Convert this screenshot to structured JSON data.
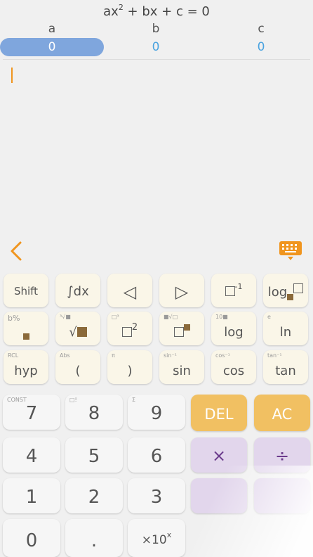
{
  "equation": {
    "lhs": "ax",
    "exponent": "2",
    "rest": " + bx + c = 0"
  },
  "coefficients": [
    {
      "label": "a",
      "value": "0"
    },
    {
      "label": "b",
      "value": "0"
    },
    {
      "label": "c",
      "value": "0"
    }
  ],
  "colors": {
    "accent": "#f0951e",
    "active_field": "#7fa6dd",
    "value_text": "#4aa3e0",
    "del_ac": "#f1c062",
    "operator": "#e2d6ec"
  },
  "keys": {
    "shift": "Shift",
    "integral": "∫dx",
    "left": "◁",
    "right": "▷",
    "inverse_sup": "-1",
    "log_base": "log",
    "percent_sub": "b%",
    "sqrt_sub": "³√■",
    "sqrt": "√",
    "square_sub": "□³",
    "square_sup": "2",
    "pow_sub": "■√□",
    "log_sub": "10■",
    "log": "log",
    "ln_sub": "e",
    "ln": "ln",
    "hyp_sub": "RCL",
    "hyp": "hyp",
    "lparen_sub": "Abs",
    "lparen": "(",
    "rparen_sub": "π",
    "rparen": ")",
    "sin_sub": "sin⁻¹",
    "sin": "sin",
    "cos_sub": "cos⁻¹",
    "cos": "cos",
    "tan_sub": "tan⁻¹",
    "tan": "tan",
    "seven_sub": "CONST",
    "seven": "7",
    "eight_sub": "□!",
    "eight": "8",
    "nine_sub": "Σ",
    "nine": "9",
    "del": "DEL",
    "ac": "AC",
    "four": "4",
    "five": "5",
    "six": "6",
    "multiply": "×",
    "divide": "÷",
    "one": "1",
    "two": "2",
    "three": "3",
    "zero": "0",
    "dot": ".",
    "exp10": "×10",
    "exp10_sup": "x"
  }
}
